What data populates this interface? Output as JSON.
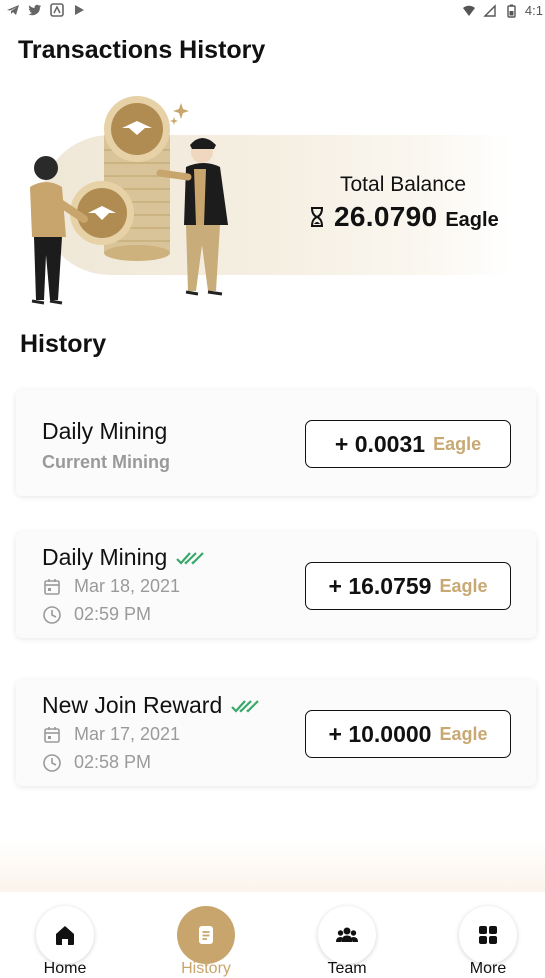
{
  "status_bar": {
    "time": "4:1",
    "left_icons": [
      "telegram-icon",
      "twitter-icon",
      "app-icon",
      "play-icon"
    ],
    "right_icons": [
      "wifi-icon",
      "signal-icon",
      "battery-icon"
    ]
  },
  "header": {
    "title": "Transactions History"
  },
  "balance": {
    "label": "Total Balance",
    "amount": "26.0790",
    "unit": "Eagle",
    "icon": "hourglass-icon"
  },
  "history": {
    "title": "History",
    "items": [
      {
        "title": "Daily Mining",
        "subtitle": "Current Mining",
        "amount": "+ 0.0031",
        "unit": "Eagle",
        "verified": false
      },
      {
        "title": "Daily Mining",
        "date": "Mar 18, 2021",
        "time": "02:59 PM",
        "amount": "+ 16.0759",
        "unit": "Eagle",
        "verified": true
      },
      {
        "title": "New Join Reward",
        "date": "Mar 17, 2021",
        "time": "02:58 PM",
        "amount": "+ 10.0000",
        "unit": "Eagle",
        "verified": true
      }
    ]
  },
  "bottom_nav": {
    "items": [
      {
        "label": "Home",
        "icon": "home-icon",
        "active": false
      },
      {
        "label": "History",
        "icon": "document-icon",
        "active": true
      },
      {
        "label": "Team",
        "icon": "team-icon",
        "active": false
      },
      {
        "label": "More",
        "icon": "grid-icon",
        "active": false
      }
    ]
  },
  "colors": {
    "accent": "#c8a56c",
    "eagle_unit": "#c8a974",
    "check_green": "#3aa86b",
    "text": "#111111",
    "muted": "#9a9a9a"
  }
}
